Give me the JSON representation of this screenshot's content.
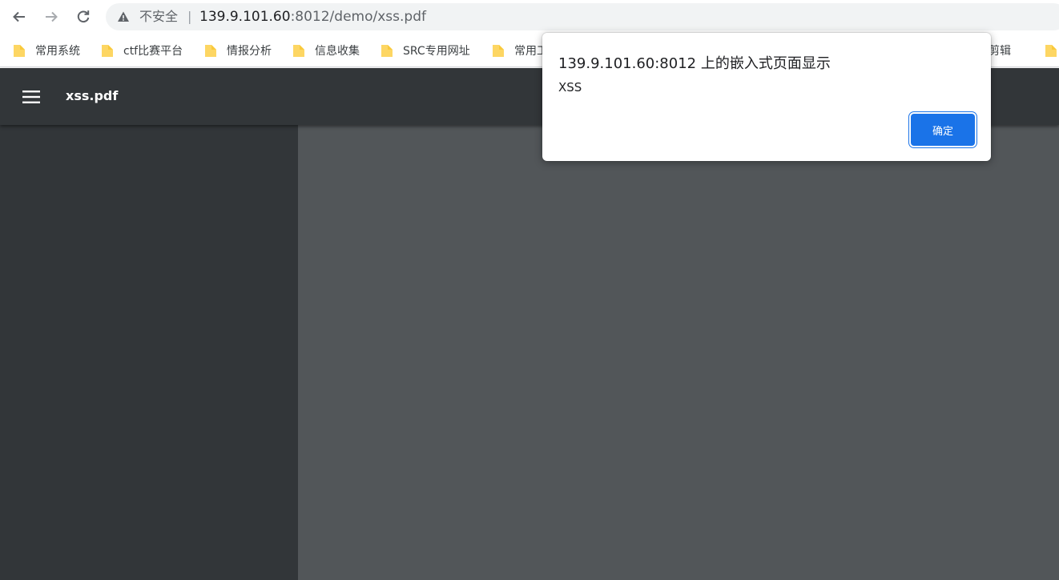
{
  "browser": {
    "security_label": "不安全",
    "separator": "|",
    "url_host": "139.9.101.60",
    "url_rest": ":8012/demo/xss.pdf"
  },
  "bookmarks": [
    {
      "label": "常用系统"
    },
    {
      "label": "ctf比赛平台"
    },
    {
      "label": "情报分析"
    },
    {
      "label": "信息收集"
    },
    {
      "label": "SRC专用网址"
    },
    {
      "label": "常用工"
    },
    {
      "label": "频剪辑"
    },
    {
      "label": ""
    }
  ],
  "viewer": {
    "title": "xss.pdf"
  },
  "dialog": {
    "title": "139.9.101.60:8012 上的嵌入式页面显示",
    "message": "XSS",
    "ok_label": "确定"
  },
  "colors": {
    "toolbar_dark": "#323639",
    "viewer_bg": "#525659",
    "accent": "#1a73e8",
    "folder": "#fdd663"
  }
}
